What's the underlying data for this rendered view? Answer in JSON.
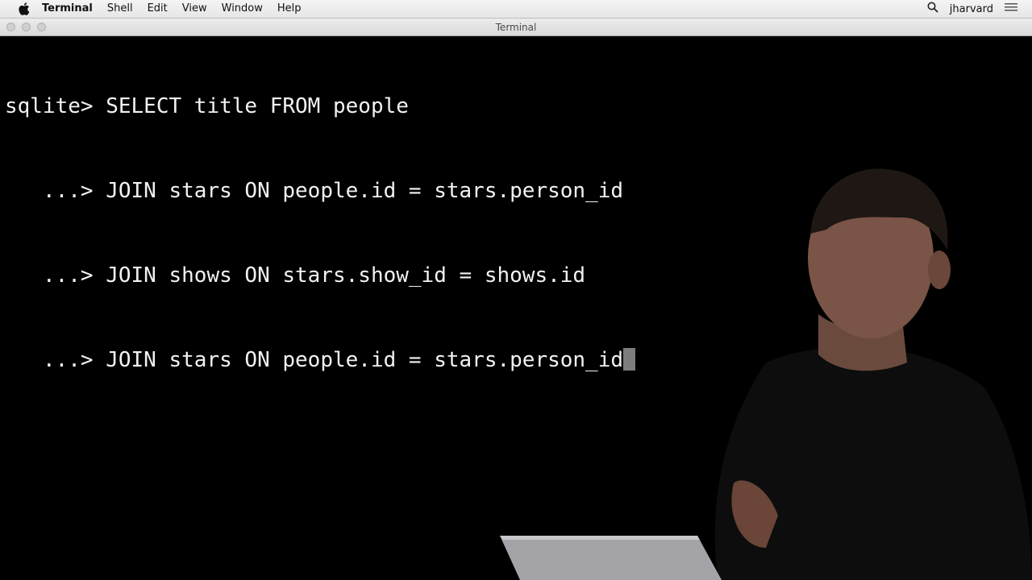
{
  "menubar": {
    "app_name": "Terminal",
    "items": [
      "Shell",
      "Edit",
      "View",
      "Window",
      "Help"
    ],
    "user": "jharvard",
    "icons": [
      "apple-icon",
      "search-icon",
      "menu-list-icon"
    ]
  },
  "window": {
    "title": "Terminal"
  },
  "terminal": {
    "lines": [
      "sqlite> SELECT title FROM people",
      "   ...> JOIN stars ON people.id = stars.person_id",
      "   ...> JOIN shows ON stars.show_id = shows.id",
      "   ...> JOIN stars ON people.id = stars.person_id"
    ],
    "colors": {
      "background": "#000000",
      "text": "#f2f2f2",
      "cursor": "#7d7d7d"
    }
  }
}
